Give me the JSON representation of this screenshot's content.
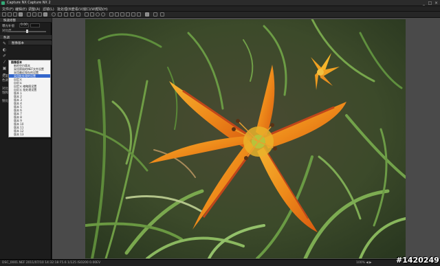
{
  "window": {
    "title": "Capture NX Capture NX 2",
    "minimize": "_",
    "maximize": "□",
    "close": "×"
  },
  "menu": {
    "items": [
      "文件(F)",
      "编辑(E)",
      "调整(A)",
      "滤镜(L)",
      "批处理(B)",
      "查看(V)",
      "窗口(W)",
      "帮助(H)"
    ]
  },
  "panel": {
    "section1_title": "快速修整",
    "section1_field_label_a": "曝光补偿",
    "section1_field_value_a": "0.00",
    "section1_field_label_b": "对比度",
    "section1_field_value_b": "0",
    "section2_title": "色调",
    "section3_title": "图像版本",
    "side_labels": [
      "亮度",
      "色调",
      "对比",
      "饱和",
      "锐化"
    ]
  },
  "dropdown": {
    "header": "图像版本",
    "items": [
      "新的空白版本",
      "采用原始的NEF文件设置",
      "采用最近保存的设置",
      "采用批处理的设置",
      "自定义",
      "自定义",
      "自定义 缩略图设置",
      "自定义 批处理设置",
      "版本 1",
      "版本 2",
      "版本 3",
      "版本 4",
      "版本 5",
      "版本 6",
      "版本 7",
      "版本 8",
      "版本 9",
      "版本 10",
      "版本 11",
      "版本 12",
      "版本 13",
      "版本 14",
      "版本 15",
      "版本 16",
      "版本 17",
      "版本 18"
    ],
    "selected_index": 3
  },
  "status": {
    "info": "DSC_0001.NEF 2011/07/10 14:32:18 F5.6 1/125 ISO200 0.00EV",
    "right": "100%  ◀ ▶"
  },
  "watermark": "#1420249"
}
